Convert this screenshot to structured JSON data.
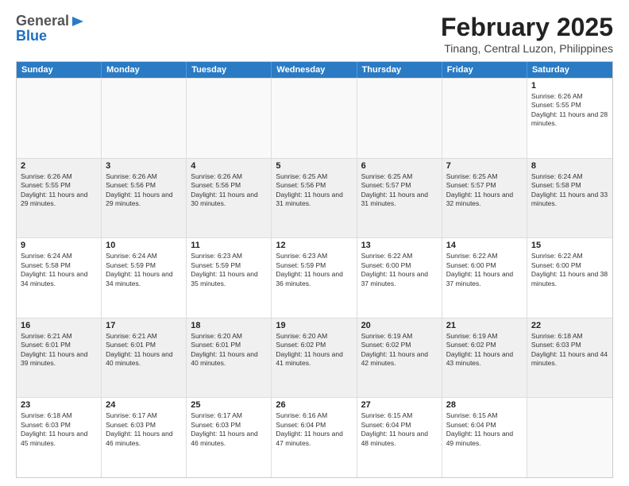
{
  "logo": {
    "general": "General",
    "blue": "Blue"
  },
  "header": {
    "month_year": "February 2025",
    "location": "Tinang, Central Luzon, Philippines"
  },
  "weekdays": [
    "Sunday",
    "Monday",
    "Tuesday",
    "Wednesday",
    "Thursday",
    "Friday",
    "Saturday"
  ],
  "rows": [
    [
      {
        "day": "",
        "info": ""
      },
      {
        "day": "",
        "info": ""
      },
      {
        "day": "",
        "info": ""
      },
      {
        "day": "",
        "info": ""
      },
      {
        "day": "",
        "info": ""
      },
      {
        "day": "",
        "info": ""
      },
      {
        "day": "1",
        "info": "Sunrise: 6:26 AM\nSunset: 5:55 PM\nDaylight: 11 hours and 28 minutes."
      }
    ],
    [
      {
        "day": "2",
        "info": "Sunrise: 6:26 AM\nSunset: 5:55 PM\nDaylight: 11 hours and 29 minutes."
      },
      {
        "day": "3",
        "info": "Sunrise: 6:26 AM\nSunset: 5:56 PM\nDaylight: 11 hours and 29 minutes."
      },
      {
        "day": "4",
        "info": "Sunrise: 6:26 AM\nSunset: 5:56 PM\nDaylight: 11 hours and 30 minutes."
      },
      {
        "day": "5",
        "info": "Sunrise: 6:25 AM\nSunset: 5:56 PM\nDaylight: 11 hours and 31 minutes."
      },
      {
        "day": "6",
        "info": "Sunrise: 6:25 AM\nSunset: 5:57 PM\nDaylight: 11 hours and 31 minutes."
      },
      {
        "day": "7",
        "info": "Sunrise: 6:25 AM\nSunset: 5:57 PM\nDaylight: 11 hours and 32 minutes."
      },
      {
        "day": "8",
        "info": "Sunrise: 6:24 AM\nSunset: 5:58 PM\nDaylight: 11 hours and 33 minutes."
      }
    ],
    [
      {
        "day": "9",
        "info": "Sunrise: 6:24 AM\nSunset: 5:58 PM\nDaylight: 11 hours and 34 minutes."
      },
      {
        "day": "10",
        "info": "Sunrise: 6:24 AM\nSunset: 5:59 PM\nDaylight: 11 hours and 34 minutes."
      },
      {
        "day": "11",
        "info": "Sunrise: 6:23 AM\nSunset: 5:59 PM\nDaylight: 11 hours and 35 minutes."
      },
      {
        "day": "12",
        "info": "Sunrise: 6:23 AM\nSunset: 5:59 PM\nDaylight: 11 hours and 36 minutes."
      },
      {
        "day": "13",
        "info": "Sunrise: 6:22 AM\nSunset: 6:00 PM\nDaylight: 11 hours and 37 minutes."
      },
      {
        "day": "14",
        "info": "Sunrise: 6:22 AM\nSunset: 6:00 PM\nDaylight: 11 hours and 37 minutes."
      },
      {
        "day": "15",
        "info": "Sunrise: 6:22 AM\nSunset: 6:00 PM\nDaylight: 11 hours and 38 minutes."
      }
    ],
    [
      {
        "day": "16",
        "info": "Sunrise: 6:21 AM\nSunset: 6:01 PM\nDaylight: 11 hours and 39 minutes."
      },
      {
        "day": "17",
        "info": "Sunrise: 6:21 AM\nSunset: 6:01 PM\nDaylight: 11 hours and 40 minutes."
      },
      {
        "day": "18",
        "info": "Sunrise: 6:20 AM\nSunset: 6:01 PM\nDaylight: 11 hours and 40 minutes."
      },
      {
        "day": "19",
        "info": "Sunrise: 6:20 AM\nSunset: 6:02 PM\nDaylight: 11 hours and 41 minutes."
      },
      {
        "day": "20",
        "info": "Sunrise: 6:19 AM\nSunset: 6:02 PM\nDaylight: 11 hours and 42 minutes."
      },
      {
        "day": "21",
        "info": "Sunrise: 6:19 AM\nSunset: 6:02 PM\nDaylight: 11 hours and 43 minutes."
      },
      {
        "day": "22",
        "info": "Sunrise: 6:18 AM\nSunset: 6:03 PM\nDaylight: 11 hours and 44 minutes."
      }
    ],
    [
      {
        "day": "23",
        "info": "Sunrise: 6:18 AM\nSunset: 6:03 PM\nDaylight: 11 hours and 45 minutes."
      },
      {
        "day": "24",
        "info": "Sunrise: 6:17 AM\nSunset: 6:03 PM\nDaylight: 11 hours and 46 minutes."
      },
      {
        "day": "25",
        "info": "Sunrise: 6:17 AM\nSunset: 6:03 PM\nDaylight: 11 hours and 46 minutes."
      },
      {
        "day": "26",
        "info": "Sunrise: 6:16 AM\nSunset: 6:04 PM\nDaylight: 11 hours and 47 minutes."
      },
      {
        "day": "27",
        "info": "Sunrise: 6:15 AM\nSunset: 6:04 PM\nDaylight: 11 hours and 48 minutes."
      },
      {
        "day": "28",
        "info": "Sunrise: 6:15 AM\nSunset: 6:04 PM\nDaylight: 11 hours and 49 minutes."
      },
      {
        "day": "",
        "info": ""
      }
    ]
  ]
}
